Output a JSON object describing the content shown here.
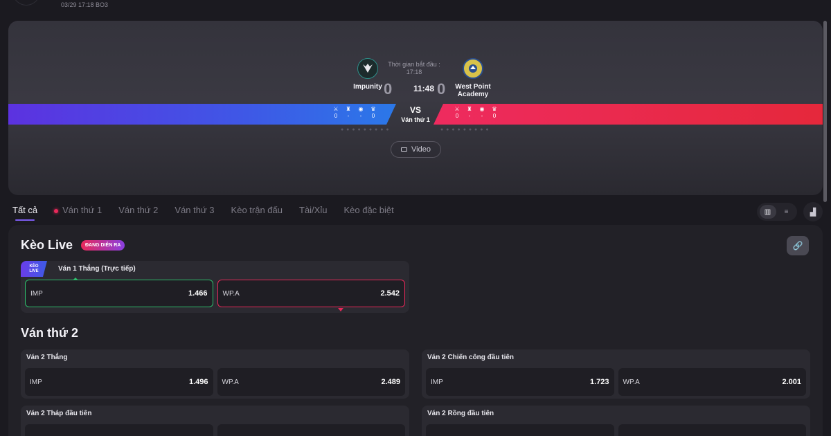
{
  "top_meta": "03/29 17:18 BO3",
  "match": {
    "start_label": "Thời gian bắt đầu :",
    "start_time": "17:18",
    "clock": "11:48",
    "vs": "VS",
    "round": "Ván thứ 1",
    "left_team": {
      "name": "Impunity",
      "score": "0",
      "stats": [
        "0",
        "-",
        "-",
        "0"
      ]
    },
    "right_team": {
      "name": "West Point Academy",
      "score": "0",
      "stats": [
        "0",
        "-",
        "-",
        "0"
      ]
    },
    "video_label": "Video"
  },
  "tabs": [
    "Tất cả",
    "Ván thứ 1",
    "Ván thứ 2",
    "Ván thứ 3",
    "Kèo trận đấu",
    "Tài/Xỉu",
    "Kèo đặc biệt"
  ],
  "live_section": {
    "title": "Kèo Live",
    "badge": "ĐANG DIỄN RA",
    "tag_line1": "KÈO",
    "tag_line2": "LIVE",
    "market": "Ván 1 Thắng (Trực tiếp)",
    "odds": [
      {
        "team": "IMP",
        "value": "1.466",
        "trend": "up"
      },
      {
        "team": "WP.A",
        "value": "2.542",
        "trend": "down"
      }
    ]
  },
  "game2": {
    "title": "Ván thứ 2",
    "markets": [
      {
        "name": "Ván 2 Thắng",
        "odds": [
          {
            "team": "IMP",
            "value": "1.496"
          },
          {
            "team": "WP.A",
            "value": "2.489"
          }
        ]
      },
      {
        "name": "Ván 2 Chiến công đầu tiên",
        "odds": [
          {
            "team": "IMP",
            "value": "1.723"
          },
          {
            "team": "WP.A",
            "value": "2.001"
          }
        ]
      },
      {
        "name": "Ván 2 Tháp đầu tiên",
        "odds": []
      },
      {
        "name": "Ván 2 Rồng đầu tiên",
        "odds": []
      }
    ]
  },
  "colors": {
    "accent": "#7c5cf0",
    "live": "#e8295a",
    "up": "#2ebd6b",
    "left_bar": "#3f57e6",
    "right_bar": "#e5283b"
  },
  "icons": [
    "video-icon",
    "grid-view-icon",
    "list-view-icon",
    "chart-icon",
    "link-icon",
    "sword-icon",
    "tower-icon",
    "dragon-icon",
    "baron-icon"
  ]
}
